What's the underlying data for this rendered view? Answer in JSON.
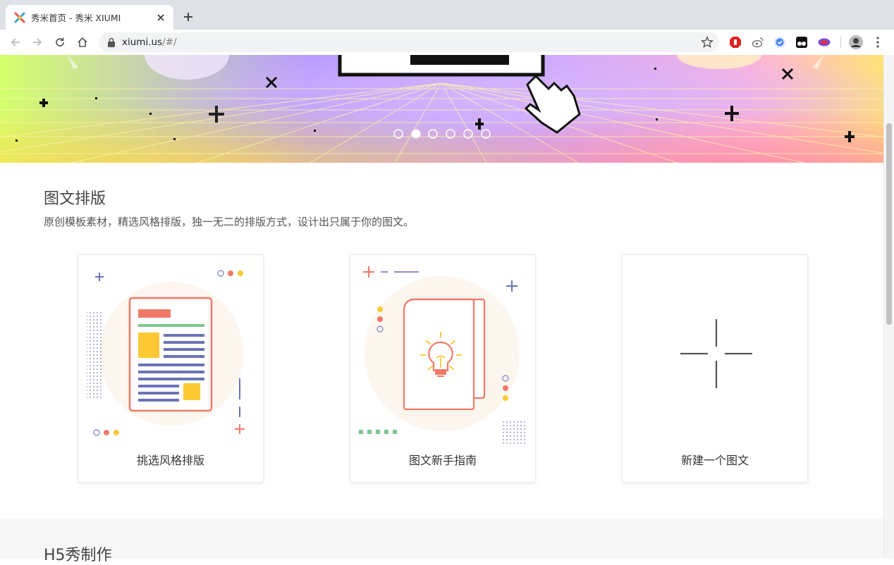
{
  "browser": {
    "tab_title": "秀米首页 - 秀米 XIUMI",
    "url_host": "xiumi.us",
    "url_path": "/#/"
  },
  "banner": {
    "active_dot": 1,
    "dot_count": 6
  },
  "section": {
    "title": "图文排版",
    "description": "原创模板素材，精选风格排版，独一无二的排版方式，设计出只属于你的图文。",
    "cards": [
      {
        "label": "挑选风格排版"
      },
      {
        "label": "图文新手指南"
      },
      {
        "label": "新建一个图文"
      }
    ]
  },
  "next_section": {
    "title": "H5秀制作"
  },
  "colors": {
    "coral": "#f07a68",
    "navy": "#6b73b5",
    "yellow": "#fcc934",
    "green": "#7ac78e",
    "soft_bg": "#fdf6ef"
  }
}
